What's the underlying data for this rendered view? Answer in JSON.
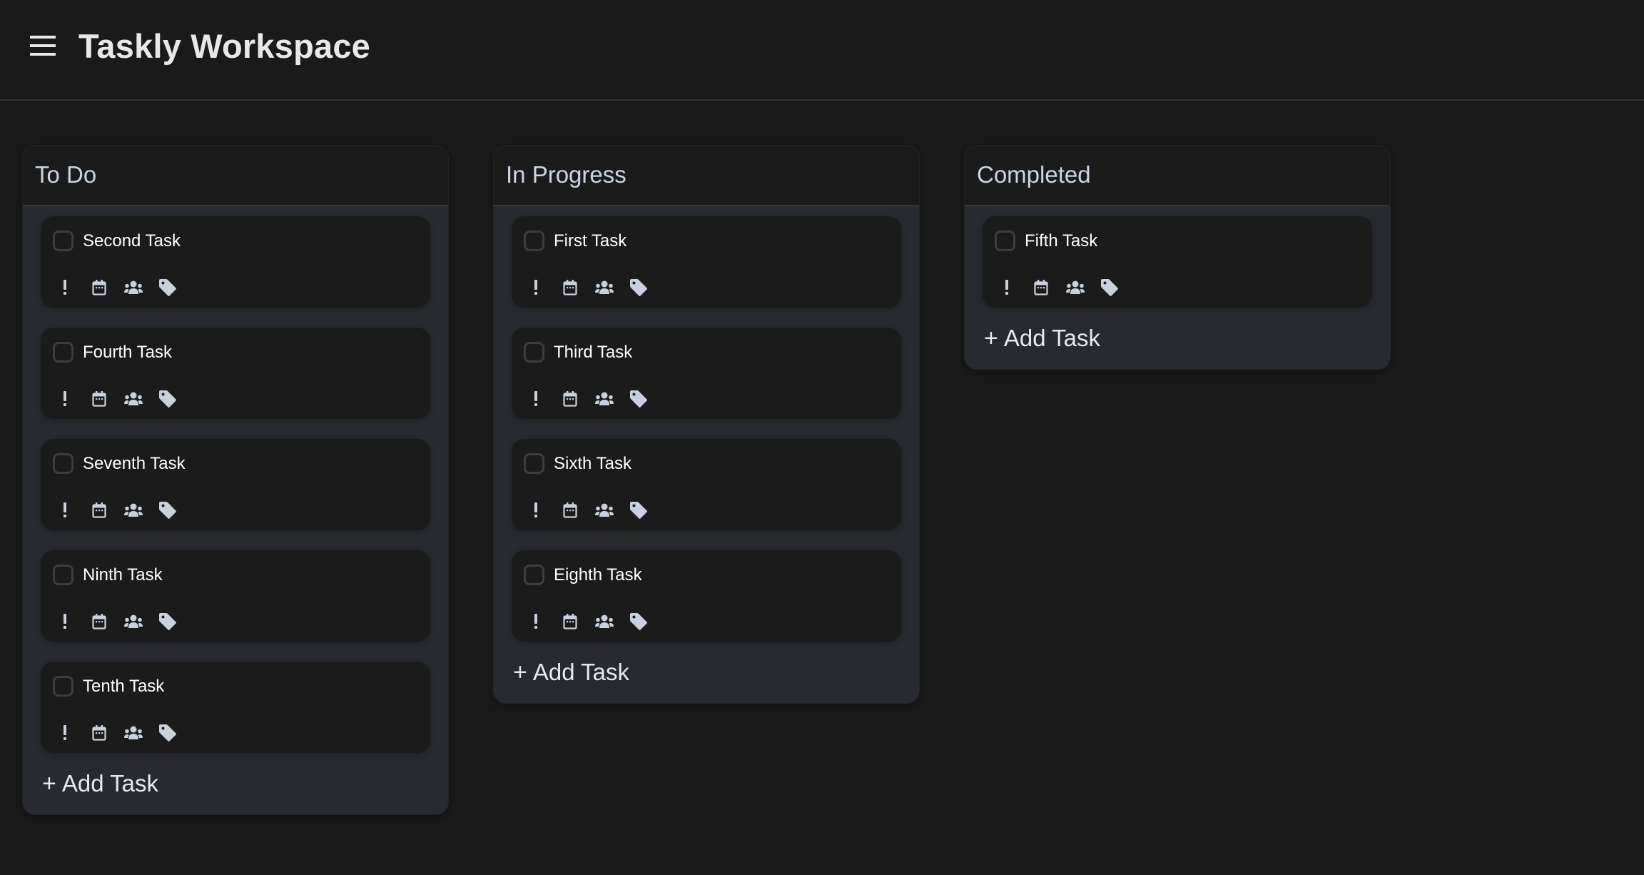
{
  "header": {
    "title": "Taskly Workspace",
    "menu_icon": "hamburger-menu-icon"
  },
  "colors": {
    "page_bg": "#1a1a1a",
    "column_body_bg": "#272a2f",
    "column_header_bg": "#1b1b1b",
    "card_bg": "#1b1b1b",
    "column_title": "#cbd5e4",
    "task_text": "#ffffff",
    "icon_color": "#c8d1dd",
    "checkbox_border": "#3b3d42"
  },
  "card_icons": [
    "priority-exclamation-icon",
    "calendar-icon",
    "users-icon",
    "tag-icon"
  ],
  "columns": [
    {
      "title": "To Do",
      "tasks": [
        {
          "title": "Second Task",
          "checked": false
        },
        {
          "title": "Fourth Task",
          "checked": false
        },
        {
          "title": "Seventh Task",
          "checked": false
        },
        {
          "title": "Ninth Task",
          "checked": false
        },
        {
          "title": "Tenth Task",
          "checked": false
        }
      ],
      "add_label": "Add Task",
      "add_icon": "+"
    },
    {
      "title": "In Progress",
      "tasks": [
        {
          "title": "First Task",
          "checked": false
        },
        {
          "title": "Third Task",
          "checked": false
        },
        {
          "title": "Sixth Task",
          "checked": false
        },
        {
          "title": "Eighth Task",
          "checked": false
        }
      ],
      "add_label": "Add Task",
      "add_icon": "+"
    },
    {
      "title": "Completed",
      "tasks": [
        {
          "title": "Fifth Task",
          "checked": false
        }
      ],
      "add_label": "Add Task",
      "add_icon": "+"
    }
  ]
}
